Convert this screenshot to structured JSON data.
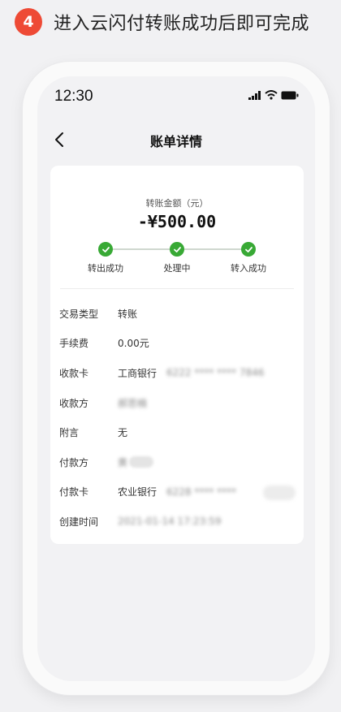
{
  "header": {
    "step_number": "4",
    "step_text": "进入云闪付转账成功后即可完成"
  },
  "status_bar": {
    "time": "12:30"
  },
  "nav": {
    "title": "账单详情"
  },
  "transfer": {
    "amount_label": "转账金额（元）",
    "amount": "-¥500.00"
  },
  "progress": {
    "steps": [
      {
        "label": "转出成功",
        "done": true
      },
      {
        "label": "处理中",
        "done": true
      },
      {
        "label": "转入成功",
        "done": true
      }
    ]
  },
  "details": {
    "type_label": "交易类型",
    "type_value": "转账",
    "fee_label": "手续费",
    "fee_value": "0.00元",
    "receive_card_label": "收款卡",
    "receive_card_bank": "工商银行",
    "receive_card_number": "6222 **** **** 7846",
    "payee_label": "收款方",
    "payee_value": "郝思楠",
    "note_label": "附言",
    "note_value": "无",
    "payer_label": "付款方",
    "payer_value": "黄",
    "pay_card_label": "付款卡",
    "pay_card_bank": "农业银行",
    "pay_card_number": "6228 **** ****",
    "created_label": "创建时间",
    "created_value": "2021-01-14 17:23:59"
  },
  "colors": {
    "accent": "#ee4a35",
    "success": "#38a935"
  }
}
